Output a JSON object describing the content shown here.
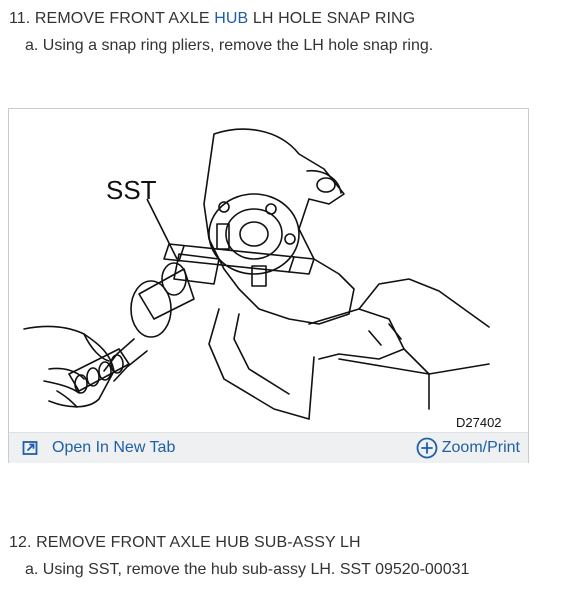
{
  "step11": {
    "title_before": "11. REMOVE FRONT AXLE ",
    "title_link": "HUB",
    "title_after": " LH HOLE SNAP RING",
    "substep": "a. Using a snap ring pliers, remove the LH hole snap ring."
  },
  "figure": {
    "sst_label": "SST",
    "figure_code": "D27402",
    "open_label": "Open In New Tab",
    "zoom_label": "Zoom/Print",
    "icons": {
      "open": "open-in-new-tab-icon",
      "zoom": "zoom-plus-icon"
    },
    "accent_color": "#1f5fa6"
  },
  "step12": {
    "title": "12. REMOVE FRONT AXLE HUB SUB-ASSY LH",
    "substep": "a. Using SST, remove the hub sub-assy LH. SST 09520-00031"
  }
}
